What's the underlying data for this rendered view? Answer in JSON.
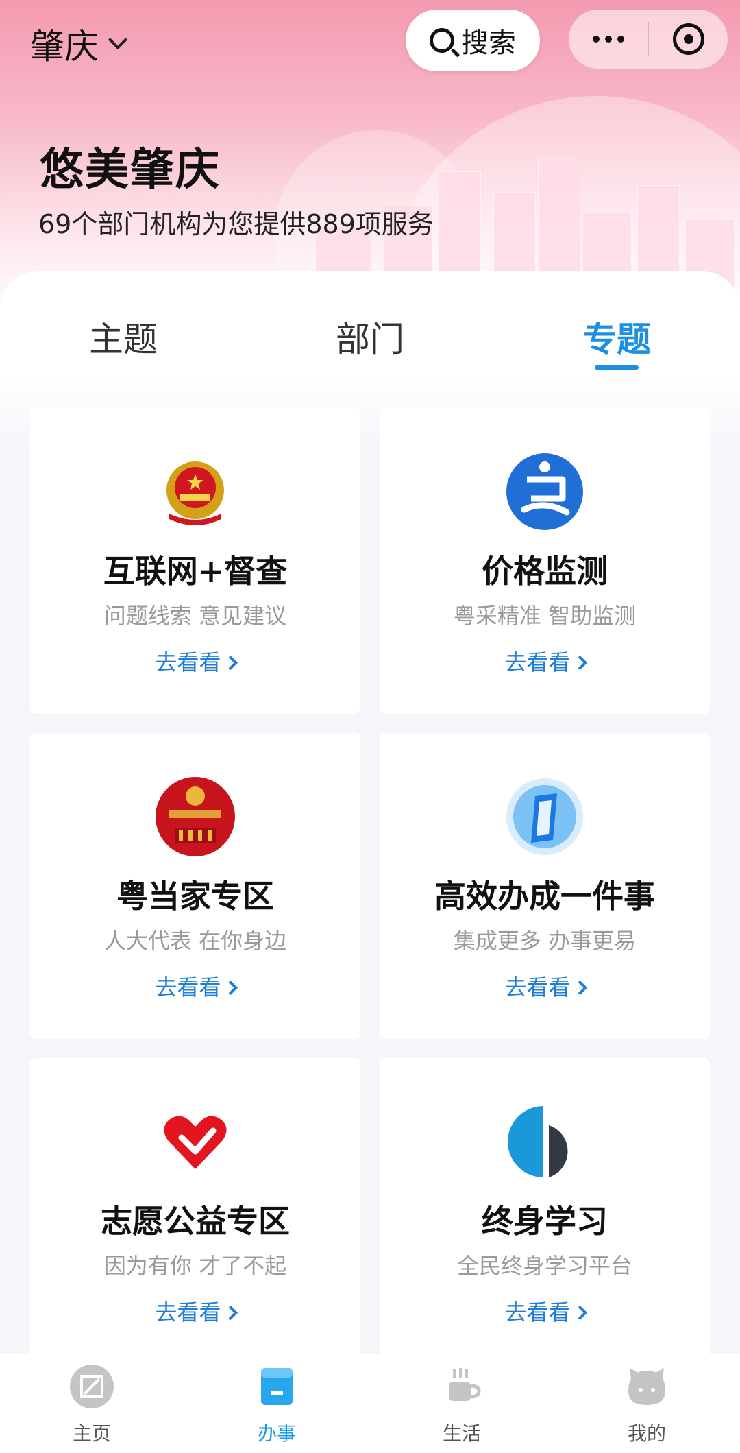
{
  "header": {
    "city": "肇庆",
    "search_label": "搜索"
  },
  "hero": {
    "title": "悠美肇庆",
    "subtitle": "69个部门机构为您提供889项服务"
  },
  "tabs": [
    {
      "label": "主题",
      "active": false
    },
    {
      "label": "部门",
      "active": false
    },
    {
      "label": "专题",
      "active": true
    }
  ],
  "cards": [
    {
      "title": "互联网+督查",
      "subtitle": "问题线索 意见建议",
      "link": "去看看",
      "icon": "national-emblem-icon"
    },
    {
      "title": "价格监测",
      "subtitle": "粤采精准 智助监测",
      "link": "去看看",
      "icon": "price-monitor-icon"
    },
    {
      "title": "粤当家专区",
      "subtitle": "人大代表 在你身边",
      "link": "去看看",
      "icon": "guangdong-npc-icon"
    },
    {
      "title": "高效办成一件事",
      "subtitle": "集成更多 办事更易",
      "link": "去看看",
      "icon": "one-thing-icon"
    },
    {
      "title": "志愿公益专区",
      "subtitle": "因为有你 才了不起",
      "link": "去看看",
      "icon": "volunteer-heart-icon"
    },
    {
      "title": "终身学习",
      "subtitle": "全民终身学习平台",
      "link": "去看看",
      "icon": "lifelong-learning-icon"
    }
  ],
  "bottom_nav": [
    {
      "label": "主页",
      "icon": "home-icon",
      "active": false
    },
    {
      "label": "办事",
      "icon": "service-icon",
      "active": true
    },
    {
      "label": "生活",
      "icon": "coffee-cup-icon",
      "active": false
    },
    {
      "label": "我的",
      "icon": "profile-icon",
      "active": false
    }
  ],
  "colors": {
    "accent": "#1a8fe3",
    "link": "#1f7fd6",
    "hero_pink": "#f49ab1"
  }
}
